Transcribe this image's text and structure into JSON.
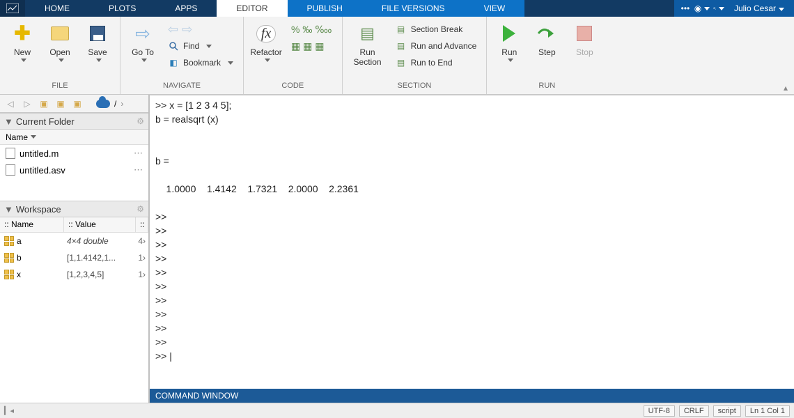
{
  "tabs": {
    "home": "HOME",
    "plots": "PLOTS",
    "apps": "APPS",
    "editor": "EDITOR",
    "publish": "PUBLISH",
    "file_versions": "FILE VERSIONS",
    "view": "VIEW"
  },
  "user": "Julio Cesar",
  "ribbon": {
    "file": {
      "new": "New",
      "open": "Open",
      "save": "Save",
      "label": "FILE"
    },
    "navigate": {
      "goto": "Go To",
      "find": "Find",
      "bookmark": "Bookmark",
      "label": "NAVIGATE"
    },
    "code": {
      "refactor": "Refactor",
      "label": "CODE"
    },
    "section": {
      "run_section": "Run\nSection",
      "section_break": "Section Break",
      "run_advance": "Run and Advance",
      "run_to_end": "Run to End",
      "label": "SECTION"
    },
    "run": {
      "run": "Run",
      "step": "Step",
      "stop": "Stop",
      "label": "RUN"
    }
  },
  "nav_path": "/",
  "current_folder": {
    "title": "Current Folder",
    "name_col": "Name",
    "files": [
      {
        "name": "untitled.m"
      },
      {
        "name": "untitled.asv"
      }
    ]
  },
  "workspace": {
    "title": "Workspace",
    "cols": {
      "name": "Name",
      "value": "Value"
    },
    "vars": [
      {
        "name": "a",
        "value": "4×4 double",
        "extra": "4›",
        "italic": true
      },
      {
        "name": "b",
        "value": "[1,1.4142,1...",
        "extra": "1›",
        "italic": false
      },
      {
        "name": "x",
        "value": "[1,2,3,4,5]",
        "extra": "1›",
        "italic": false
      }
    ]
  },
  "editor_text": ">> x = [1 2 3 4 5];\nb = realsqrt (x)\n\n\nb =\n\n    1.0000    1.4142    1.7321    2.0000    2.2361\n\n>> \n>> \n>> \n>> \n>> \n>> \n>> \n>> \n>> \n>> \n>> |",
  "command_window": "COMMAND WINDOW",
  "status": {
    "enc": "UTF-8",
    "eol": "CRLF",
    "type": "script",
    "pos": "Ln 1  Col 1"
  }
}
